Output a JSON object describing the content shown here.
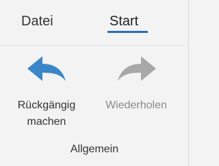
{
  "tabs": [
    {
      "label": "Datei",
      "selected": false
    },
    {
      "label": "Start",
      "selected": true
    }
  ],
  "group": {
    "label": "Allgemein",
    "commands": [
      {
        "label_line1": "Rückgängig",
        "label_line2": "machen",
        "icon": "undo-arrow-icon",
        "enabled": true
      },
      {
        "label_line1": "Wiederholen",
        "label_line2": "",
        "icon": "redo-arrow-icon",
        "enabled": false
      }
    ]
  },
  "colors": {
    "accent": "#2b6cb8",
    "undo_icon": "#3a86c8",
    "redo_icon_disabled": "#a8a8a8",
    "background": "#f3f3f3"
  }
}
